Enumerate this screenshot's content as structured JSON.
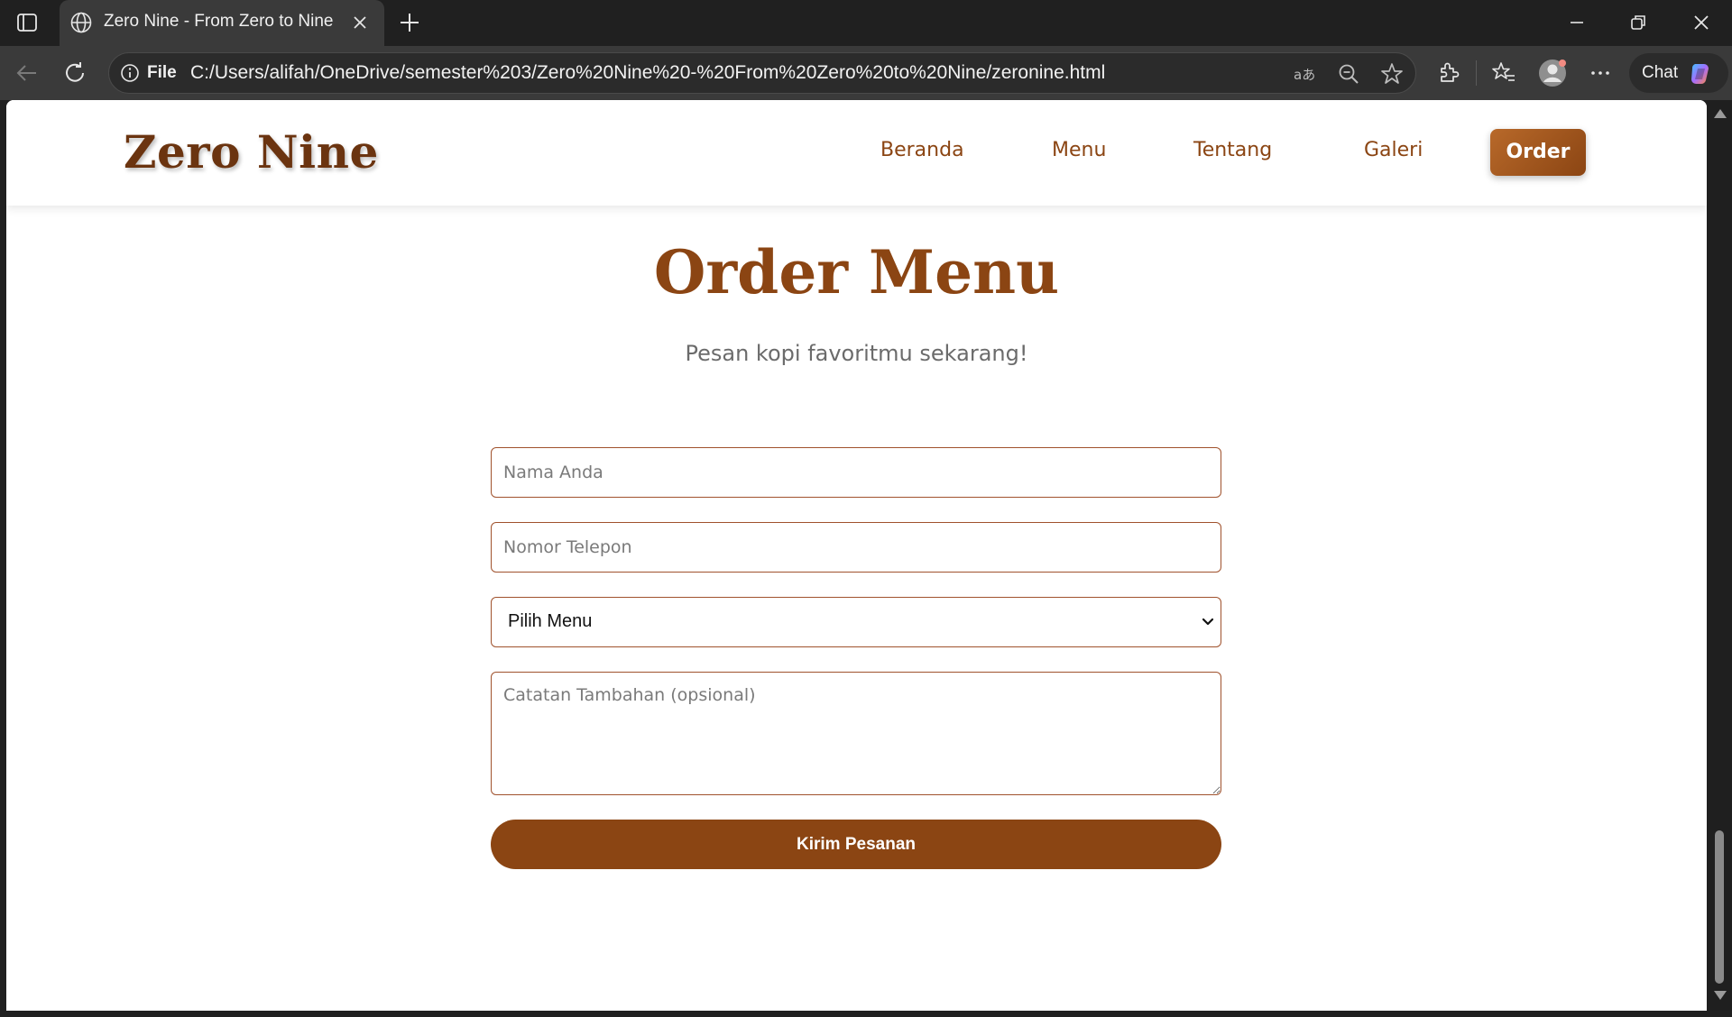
{
  "browser": {
    "tab_title": "Zero Nine - From Zero to Nine",
    "file_label": "File",
    "url": "C:/Users/alifah/OneDrive/semester%203/Zero%20Nine%20-%20From%20Zero%20to%20Nine/zeronine.html",
    "chat_label": "Chat"
  },
  "site": {
    "logo": "Zero Nine",
    "nav": {
      "home": "Beranda",
      "menu": "Menu",
      "about": "Tentang",
      "gallery": "Galeri",
      "order": "Order"
    }
  },
  "order": {
    "title": "Order Menu",
    "subtitle": "Pesan kopi favoritmu sekarang!",
    "name_placeholder": "Nama Anda",
    "phone_placeholder": "Nomor Telepon",
    "menu_select_value": "Pilih Menu",
    "notes_placeholder": "Catatan Tambahan (opsional)",
    "submit_label": "Kirim Pesanan"
  },
  "colors": {
    "brand": "#8b4513",
    "brand_light": "#b8692a",
    "chrome_dark": "#202020",
    "chrome_toolbar": "#3a3a3a"
  }
}
